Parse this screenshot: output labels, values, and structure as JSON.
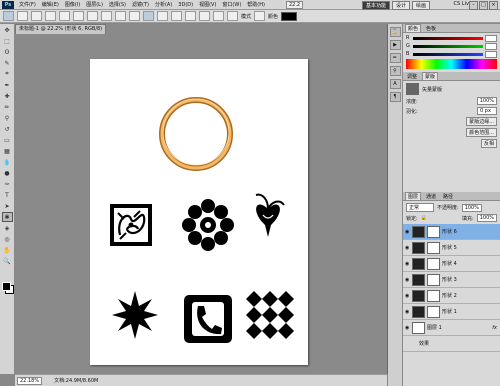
{
  "app": {
    "logo": "Ps",
    "menus": [
      "文件(F)",
      "编辑(E)",
      "图像(I)",
      "图层(L)",
      "选择(S)",
      "滤镜(T)",
      "分析(A)",
      "3D(D)",
      "视图(V)",
      "窗口(W)",
      "帮助(H)"
    ],
    "zoom": "22.2",
    "workspaces": [
      "基本功能",
      "设计",
      "绘画"
    ],
    "cs_live": "CS Live"
  },
  "options": {
    "mode_label": "模式",
    "color_label": "颜色"
  },
  "document": {
    "tab_title": "未标题-1 @ 22.2% (形状 6, RGB/8)",
    "status_zoom": "22.18%",
    "status_doc": "文档:24.9M/8.60M"
  },
  "color_panel": {
    "tabs": [
      "颜色",
      "色板"
    ],
    "channels": [
      {
        "name": "R",
        "value": "",
        "color": "#e02020"
      },
      {
        "name": "G",
        "value": "",
        "color": "#20b020"
      },
      {
        "name": "B",
        "value": "",
        "color": "#2040e0"
      }
    ]
  },
  "adjust_panel": {
    "tabs": [
      "调整",
      "蒙版"
    ],
    "title": "矢量蒙版",
    "density_label": "浓度:",
    "density_value": "100%",
    "feather_label": "羽化:",
    "feather_value": "0 px",
    "buttons": [
      "蒙版边缘...",
      "颜色范围...",
      "反相"
    ]
  },
  "layers_panel": {
    "tabs": [
      "图层",
      "通道",
      "路径"
    ],
    "blend_mode": "正常",
    "opacity_label": "不透明度:",
    "opacity_value": "100%",
    "lock_label": "锁定:",
    "fill_label": "填充:",
    "fill_value": "100%",
    "layers": [
      {
        "name": "形状 6",
        "selected": true
      },
      {
        "name": "形状 5",
        "selected": false
      },
      {
        "name": "形状 4",
        "selected": false
      },
      {
        "name": "形状 3",
        "selected": false
      },
      {
        "name": "形状 2",
        "selected": false
      },
      {
        "name": "形状 1",
        "selected": false
      }
    ],
    "layer1": "图层 1",
    "effects_label": "效果",
    "fx": "fx"
  },
  "colors": {
    "accent": "#7fb0e6",
    "ring": "#d98a2a"
  }
}
